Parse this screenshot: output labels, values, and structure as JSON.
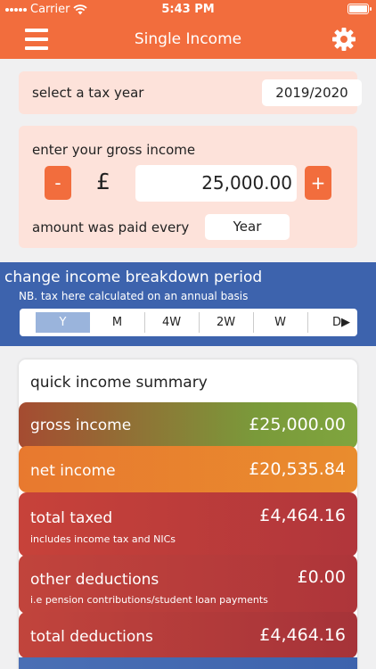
{
  "status_bar": {
    "carrier": "Carrier",
    "time": "5:43 PM",
    "battery_level": 1.0
  },
  "nav": {
    "title": "Single Income"
  },
  "tax_year": {
    "label": "select a tax year",
    "value": "2019/2020"
  },
  "income": {
    "label": "enter your gross income",
    "decrement": "-",
    "increment": "+",
    "currency": "£",
    "value": "25,000.00",
    "paid_label": "amount was paid every",
    "paid_period": "Year"
  },
  "breakdown": {
    "title": "change income breakdown period",
    "note": "NB. tax here calculated on an annual basis",
    "segments": [
      "Y",
      "M",
      "4W",
      "2W",
      "W",
      "D▶"
    ],
    "selected": "Y"
  },
  "summary": {
    "title": "quick income summary",
    "gross": {
      "label": "gross income",
      "value": "£25,000.00"
    },
    "net": {
      "label": "net income",
      "value": "£20,535.84"
    },
    "taxed": {
      "label": "total taxed",
      "value": "£4,464.16",
      "note": "includes income tax and NICs"
    },
    "other": {
      "label": "other deductions",
      "value": "£0.00",
      "note": "i.e pension contributions/student loan payments"
    },
    "total": {
      "label": "total deductions",
      "value": "£4,464.16"
    }
  },
  "colors": {
    "accent": "#f26d3d",
    "blue": "#3d63ad",
    "card_bg": "#fde2da"
  }
}
